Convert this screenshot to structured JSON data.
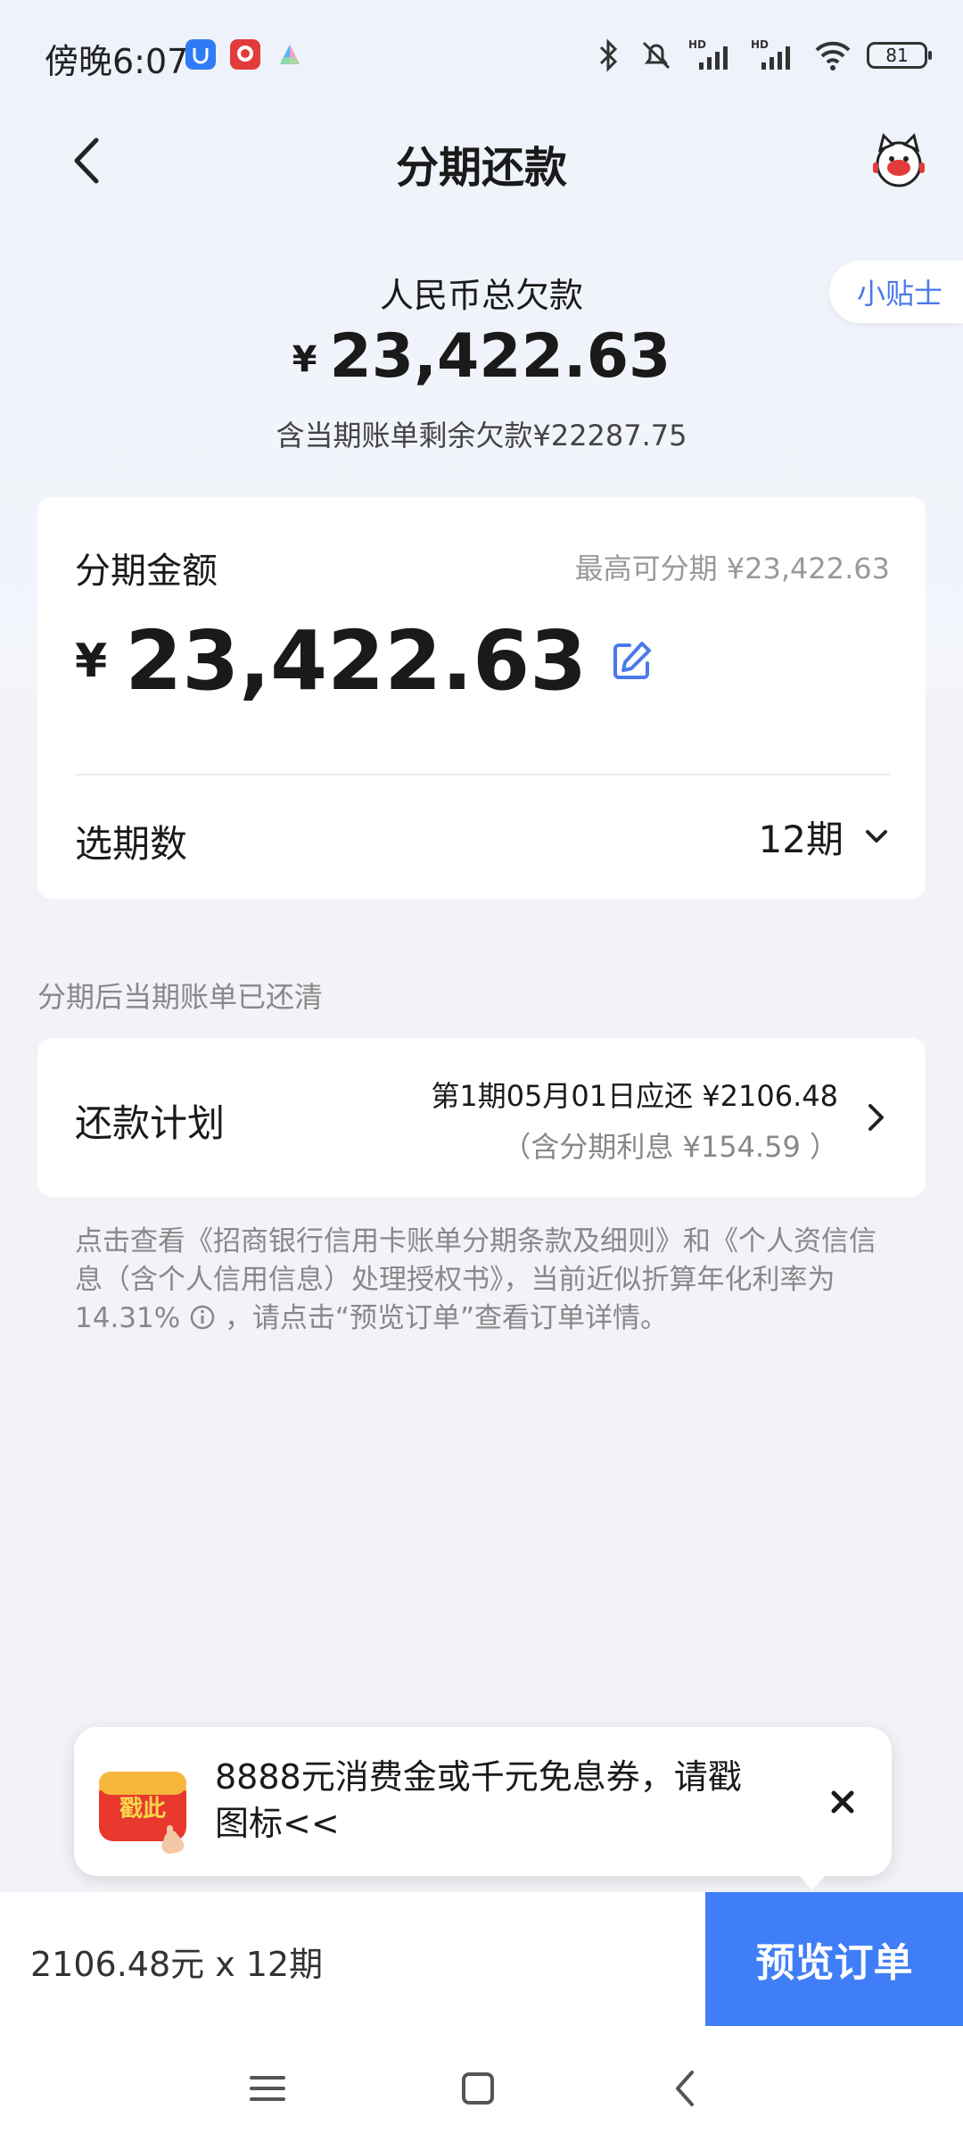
{
  "status_bar": {
    "time": "傍晚6:07",
    "battery": "81",
    "signal_label": "HD"
  },
  "header": {
    "title": "分期还款"
  },
  "tips": {
    "label": "小贴士"
  },
  "debt": {
    "label": "人民币总欠款",
    "currency": "¥",
    "amount": "23,422.63",
    "sub": "含当期账单剩余欠款¥22287.75"
  },
  "amount_card": {
    "label": "分期金额",
    "max_text": "最高可分期 ¥23,422.63",
    "currency": "¥",
    "amount": "23,422.63",
    "period_label": "选期数",
    "period_value": "12期"
  },
  "after_note": "分期后当期账单已还清",
  "plan_card": {
    "label": "还款计划",
    "line1": "第1期05月01日应还 ¥2106.48",
    "line2": "（含分期利息 ¥154.59 ）"
  },
  "disclaimer": {
    "part1": "点击查看《招商银行信用卡账单分期条款及细则》和《个人资信信息（含个人信用信息）处理授权书》，当前近似折算年化利率为14.31%",
    "part2": "，请点击“预览订单”查看订单详情。"
  },
  "promo": {
    "icon_text": "戳此",
    "text": "8888元消费金或千元免息券，请戳图标<<"
  },
  "bottom": {
    "summary": "2106.48元 x 12期",
    "preview_label": "预览订单"
  },
  "colors": {
    "accent": "#3f7ef6",
    "link": "#4a7ae8",
    "background": "#f1f3f8"
  }
}
